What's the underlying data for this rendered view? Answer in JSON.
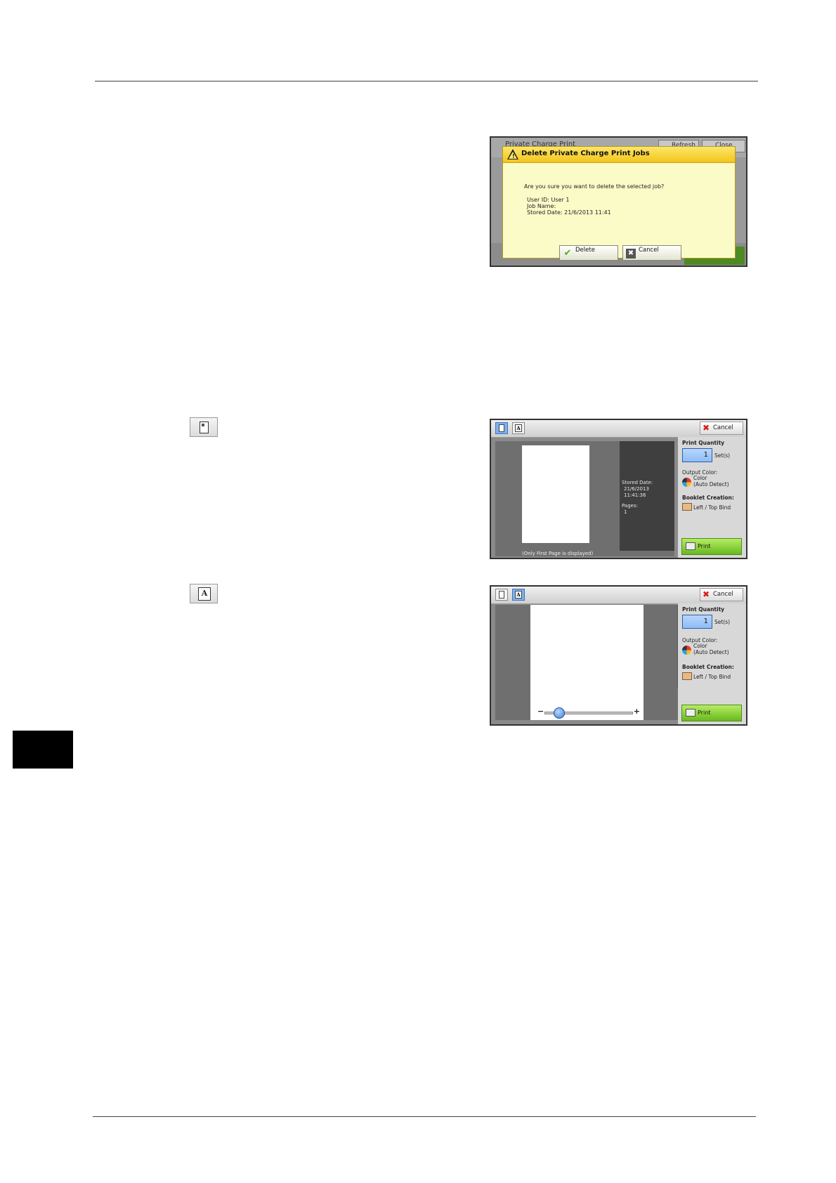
{
  "delete_dialog": {
    "bg_title": "Private Charge Print",
    "bg_refresh": "Refresh",
    "bg_close": "Close",
    "title": "Delete Private Charge Print Jobs",
    "message": "Are you sure you want to delete the selected job?",
    "user_id": "User ID: User 1",
    "job_name": "Job Name:",
    "stored_date": "Stored Date: 21/6/2013 11:41",
    "delete_label": "Delete",
    "cancel_label": "Cancel"
  },
  "preview_page": {
    "cancel_label": "Cancel",
    "stored_date_label": "Stored Date:",
    "stored_date_value": "21/6/2013",
    "stored_time_value": "11:41:36",
    "pages_label": "Pages:",
    "pages_value": "1",
    "caption": "(Only First Page is displayed)",
    "print_quantity_label": "Print Quantity",
    "quantity_value": "1",
    "sets_label": "Set(s)",
    "output_color_label": "Output Color:",
    "output_color_value": "Color",
    "output_color_sub": "(Auto Detect)",
    "booklet_label": "Booklet Creation:",
    "booklet_value": "Left / Top Bind",
    "print_label": "Print"
  },
  "preview_zoom": {
    "cancel_label": "Cancel",
    "print_quantity_label": "Print Quantity",
    "quantity_value": "1",
    "sets_label": "Set(s)",
    "output_color_label": "Output Color:",
    "output_color_value": "Color",
    "output_color_sub": "(Auto Detect)",
    "booklet_label": "Booklet Creation:",
    "booklet_value": "Left / Top Bind",
    "print_label": "Print",
    "zoom_fraction": 0.12
  },
  "icons": {
    "page_view": "page-view-icon",
    "zoom_view": "zoom-view-icon"
  }
}
